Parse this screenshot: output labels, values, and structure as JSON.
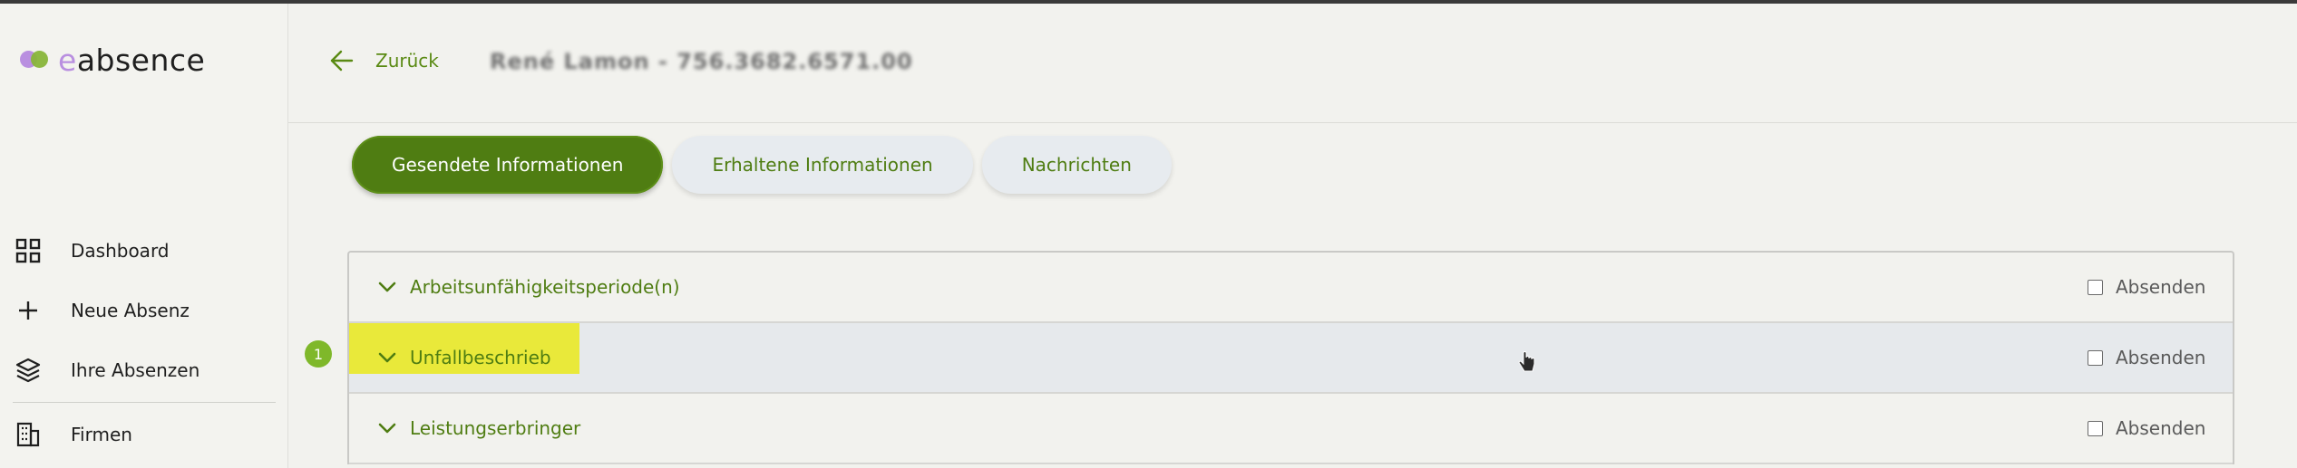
{
  "app": {
    "logo_prefix": "e",
    "logo_rest": "absence"
  },
  "sidebar": {
    "items": [
      {
        "label": "Dashboard",
        "icon": "grid-icon"
      },
      {
        "label": "Neue Absenz",
        "icon": "plus-icon"
      },
      {
        "label": "Ihre Absenzen",
        "icon": "layers-icon"
      },
      {
        "label": "Firmen",
        "icon": "building-icon"
      }
    ]
  },
  "header": {
    "back_label": "Zurück",
    "person": "René Lamon - 756.3682.6571.00"
  },
  "tabs": [
    {
      "label": "Gesendete Informationen",
      "active": true
    },
    {
      "label": "Erhaltene Informationen",
      "active": false
    },
    {
      "label": "Nachrichten",
      "active": false
    }
  ],
  "sections": [
    {
      "label": "Arbeitsunfähigkeitsperiode(n)",
      "send_label": "Absenden",
      "checked": false
    },
    {
      "label": "Unfallbeschrieb",
      "send_label": "Absenden",
      "checked": false,
      "badge": "1",
      "highlight_color": "#e9e93a"
    },
    {
      "label": "Leistungserbringer",
      "send_label": "Absenden",
      "checked": false
    }
  ],
  "colors": {
    "accent": "#4f7d12",
    "badge": "#7fb82a",
    "highlight": "#e9e93a"
  }
}
